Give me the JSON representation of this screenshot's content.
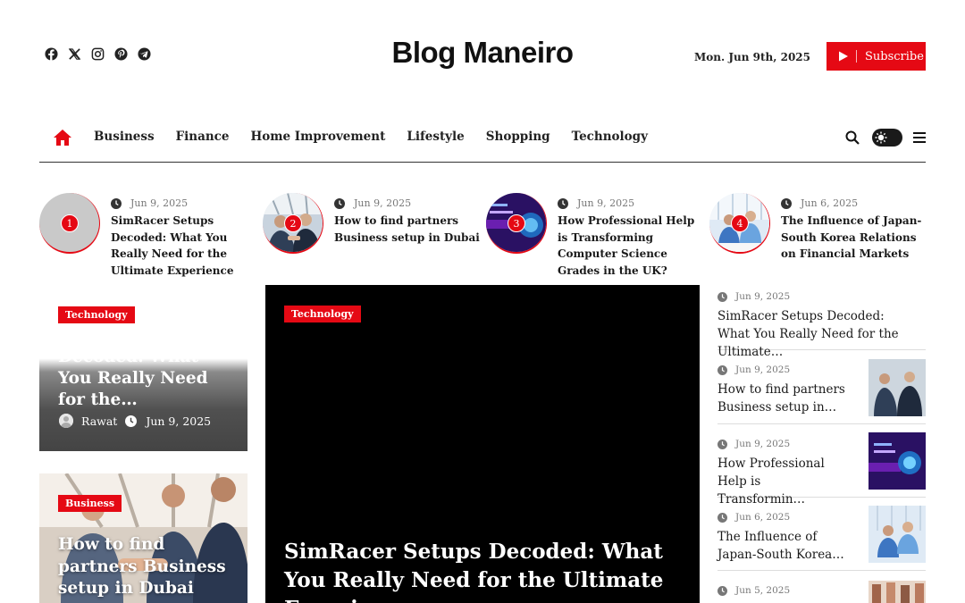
{
  "social": [
    "facebook-icon",
    "x-icon",
    "instagram-icon",
    "pinterest-icon",
    "telegram-icon"
  ],
  "site_title": "Blog Maneiro",
  "date": "Mon. Jun 9th, 2025",
  "subscribe_label": "Subscribe",
  "colors": {
    "accent": "#e50914",
    "text": "#1a1a1a",
    "meta": "#777777",
    "hero_bg": "#000000"
  },
  "nav": {
    "items": [
      "Business",
      "Finance",
      "Home Improvement",
      "Lifestyle",
      "Shopping",
      "Technology"
    ]
  },
  "trending": [
    {
      "num": "1",
      "date": "Jun 9, 2025",
      "title": "SimRacer Setups Decoded: What You Really Need for the Ultimate Experience"
    },
    {
      "num": "2",
      "date": "Jun 9, 2025",
      "title": "How to find partners Business setup in Dubai"
    },
    {
      "num": "3",
      "date": "Jun 9, 2025",
      "title": "How Professional Help is Transforming Computer Science Grades in the UK?"
    },
    {
      "num": "4",
      "date": "Jun 6, 2025",
      "title": "The Influence of Japan-South Korea Relations on Financial Markets"
    }
  ],
  "card1": {
    "tag": "Technology",
    "title": "Decoded: What You Really Need for the…",
    "author": "Rawat",
    "date": "Jun 9, 2025"
  },
  "card2": {
    "tag": "Business",
    "title": "How to find partners Business setup in Dubai"
  },
  "hero": {
    "tag": "Technology",
    "title": "SimRacer Setups Decoded: What You Really Need for the Ultimate Experience"
  },
  "side": [
    {
      "date": "Jun 9, 2025",
      "title": "SimRacer Setups Decoded: What You Really Need for the Ultimate…"
    },
    {
      "date": "Jun 9, 2025",
      "title": "How to find partners Business setup in…"
    },
    {
      "date": "Jun 9, 2025",
      "title": "How Professional Help is Transformin…"
    },
    {
      "date": "Jun 6, 2025",
      "title": "The Influence of Japan-South Korea…"
    },
    {
      "date": "Jun 5, 2025",
      "title": ""
    }
  ]
}
